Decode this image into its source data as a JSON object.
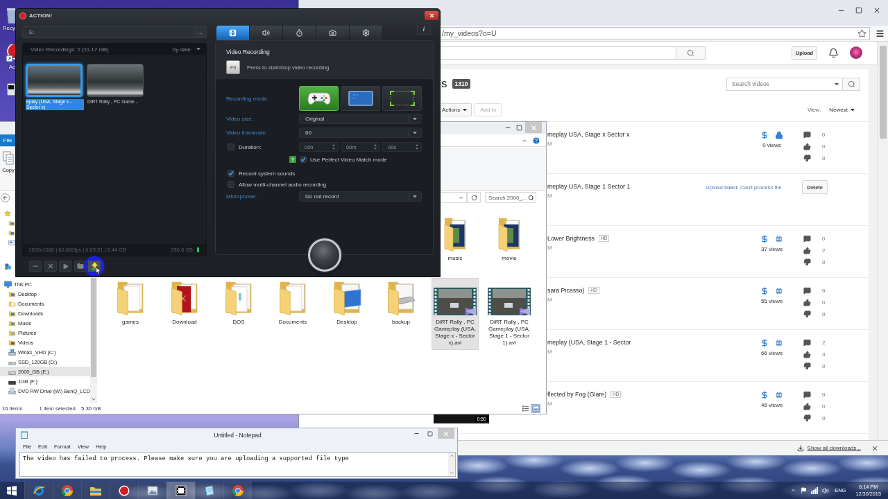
{
  "desktop": {
    "icons": [
      {
        "kind": "recycle_bin",
        "label": "Recy"
      },
      {
        "kind": "action",
        "label": "Ac"
      },
      {
        "kind": "app"
      }
    ]
  },
  "browser": {
    "address": "/my_videos?o=U",
    "upload": "Upload",
    "heading": "s",
    "video_count": "1310",
    "search_placeholder": "Search videos",
    "actions": "Actions",
    "add_to": {
      "label": "Add to",
      "disabled": true
    },
    "view_label": "View:",
    "sort": "Newest",
    "videos": [
      {
        "kind": "published",
        "title": "meplay USA, Stage x Sector x",
        "date": "M",
        "private": true,
        "views": "0 views",
        "comments": "0",
        "likes": "0",
        "dislikes": "0"
      },
      {
        "kind": "failed",
        "title": "meplay USA, Stage 1 Sector 1",
        "date": "M",
        "status": "Upload failed: Can't process file",
        "action": "Delete"
      },
      {
        "kind": "published",
        "title": "Lower Brightness",
        "badge": "HD",
        "date": "M",
        "private": false,
        "views": "37 views",
        "comments": "0",
        "likes": "2",
        "dislikes": "0"
      },
      {
        "kind": "published",
        "title": "sara Picasso)",
        "badge": "HD",
        "date": "M",
        "private": false,
        "views": "55 views",
        "comments": "0",
        "likes": "0",
        "dislikes": "0"
      },
      {
        "kind": "published",
        "title": "meplay (USA, Stage 1 - Sector",
        "date": "M",
        "private": false,
        "views": "66 views",
        "comments": "2",
        "likes": "3",
        "dislikes": "0"
      },
      {
        "kind": "published",
        "title": "flected by Fog (Glare)",
        "badge": "HD",
        "date": "M",
        "private": false,
        "views": "46 views",
        "comments": "0",
        "likes": "0",
        "dislikes": "0",
        "duration": "0:50"
      }
    ],
    "downloads_link": "Show all downloads..."
  },
  "explorer": {
    "ribbon_tab": "File",
    "copy": "Copy",
    "search_placeholder": "Search 2000_...",
    "nav": [
      {
        "label": "This PC",
        "kind": "pc",
        "selected": false,
        "children": [
          {
            "label": "Desktop",
            "kind": "desktop",
            "selected": false
          },
          {
            "label": "Documents",
            "kind": "documents",
            "selected": false
          },
          {
            "label": "Downloads",
            "kind": "downloads",
            "selected": false
          },
          {
            "label": "Music",
            "kind": "music",
            "selected": false
          },
          {
            "label": "Pictures",
            "kind": "pictures",
            "selected": false
          },
          {
            "label": "Videos",
            "kind": "videos",
            "selected": false
          },
          {
            "label": "Win81_VHD (C:)",
            "kind": "system_drive",
            "selected": false
          },
          {
            "label": "SSD_120GB (D:)",
            "kind": "drive",
            "selected": false
          },
          {
            "label": "2000_GB (E:)",
            "kind": "drive",
            "selected": true
          },
          {
            "label": "1GB (F:)",
            "kind": "removable",
            "selected": false
          },
          {
            "label": "DVD RW Drive (W:) BenQ_LCD",
            "kind": "dvd",
            "selected": false
          }
        ]
      }
    ],
    "items_row_1": [
      {
        "name": "music",
        "kind": "media_folder",
        "selected": false
      },
      {
        "name": "movie",
        "kind": "media_folder",
        "selected": false
      }
    ],
    "items_row_2": [
      {
        "name": "games",
        "kind": "folder",
        "selected": false
      },
      {
        "name": "Download",
        "kind": "red_folder",
        "selected": false
      },
      {
        "name": "DOS",
        "kind": "document_folder",
        "selected": false
      },
      {
        "name": "Documents",
        "kind": "folder",
        "selected": false
      },
      {
        "name": "Desktop",
        "kind": "desktop_folder",
        "selected": false
      },
      {
        "name": "backup",
        "kind": "drive_folder",
        "selected": false
      },
      {
        "name": "DiRT Rally , PC Gameplay (USA, Stage x - Sector x).avi",
        "kind": "video",
        "selected": true
      },
      {
        "name": "DiRT Rally , PC Gameplay (USA, Stage 1 - Sector 1).avi",
        "kind": "video",
        "selected": false
      }
    ],
    "item_count": "16 items",
    "selection": "1 item selected",
    "selection_size": "5.30 GB",
    "view_modes": [
      {
        "kind": "details",
        "selected": false
      },
      {
        "kind": "large_icons",
        "selected": true
      }
    ]
  },
  "action": {
    "title": "ACTION!",
    "path": "E:",
    "browse": "...",
    "recordings": {
      "header": "Video Recordings: 2 (11.17 GB)",
      "sort": "by date",
      "items": [
        {
          "caption": "eplay (USA, Stage x - Sector x)",
          "selected": true
        },
        {
          "caption": "DiRT Rally , PC Game...",
          "selected": false
        }
      ],
      "info": "1920x1080 | 60.000fps | 0:03:21 | 5.44 GB",
      "free_space": "290.8 GB"
    },
    "toolbar": [
      {
        "kind": "minimize",
        "highlighted": false
      },
      {
        "kind": "delete",
        "highlighted": false
      },
      {
        "kind": "play",
        "highlighted": false
      },
      {
        "kind": "browse",
        "highlighted": false
      },
      {
        "kind": "upload",
        "highlighted": true
      }
    ],
    "settings": {
      "tabs": [
        {
          "kind": "video",
          "selected": true
        },
        {
          "kind": "audio",
          "selected": false
        },
        {
          "kind": "timer",
          "selected": false
        },
        {
          "kind": "screenshot",
          "selected": false
        },
        {
          "kind": "settings",
          "selected": false
        }
      ],
      "info": "i",
      "section": "Video Recording",
      "hotkey": "F9",
      "hotkey_hint": "Press to start/stop video recording",
      "mode_label": "Recording mode:",
      "modes": [
        {
          "kind": "game",
          "selected": true
        },
        {
          "kind": "desktop",
          "selected": false
        },
        {
          "kind": "area",
          "selected": false
        }
      ],
      "video_size": {
        "label": "Video size:",
        "value": "Original"
      },
      "framerate": {
        "label": "Video framerate:",
        "value": "60"
      },
      "duration": {
        "label": "Duration:",
        "checked": false,
        "hours": "00h",
        "minutes": "00m",
        "seconds": "00s"
      },
      "perfect_match": {
        "help": "?",
        "label": "Use Perfect Video Match mode",
        "checked": true
      },
      "system_sounds": {
        "label": "Record system sounds",
        "checked": true
      },
      "multichannel": {
        "label": "Allow multi-channel audio recording",
        "checked": false
      },
      "microphone": {
        "label": "Microphone:",
        "value": "Do not record"
      }
    }
  },
  "notepad": {
    "title": "Untitled - Notepad",
    "menu": [
      "File",
      "Edit",
      "Format",
      "View",
      "Help"
    ],
    "text": "The video has failed to process. Please make sure you are uploading a supported file type"
  },
  "taskbar": {
    "apps": [
      {
        "kind": "internet_explorer",
        "selected": false
      },
      {
        "kind": "chrome",
        "selected": false
      },
      {
        "kind": "file_explorer",
        "selected": false
      },
      {
        "kind": "action",
        "selected": false
      },
      {
        "kind": "photos",
        "selected": false
      },
      {
        "kind": "video",
        "selected": true
      },
      {
        "kind": "notepad",
        "selected": false
      },
      {
        "kind": "chrome",
        "selected": false
      }
    ],
    "language": "ENG",
    "time": "6:14 PM",
    "date": "12/30/2015"
  }
}
